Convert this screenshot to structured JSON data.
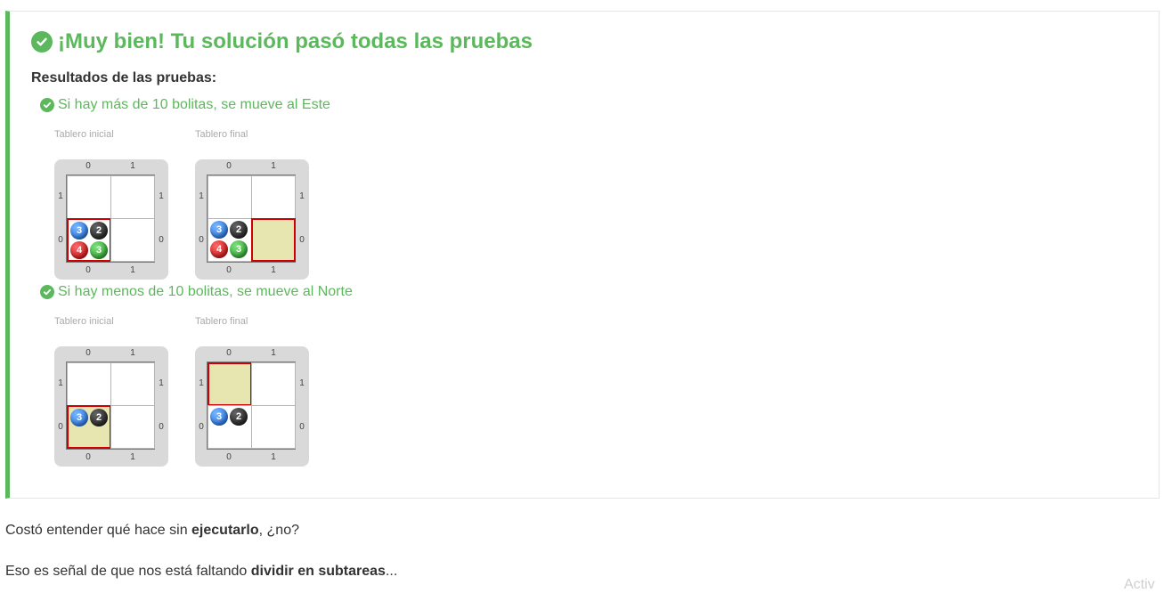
{
  "result": {
    "title": "¡Muy bien! Tu solución pasó todas las pruebas",
    "results_heading": "Resultados de las pruebas:",
    "accent_color": "#5cb85c",
    "icon": "check-circle-icon"
  },
  "tests": [
    {
      "title": "Si hay más de 10 bolitas, se mueve al Este",
      "initial_caption": "Tablero inicial",
      "final_caption": "Tablero final",
      "initial_board": {
        "col_labels": [
          "0",
          "1"
        ],
        "row_labels": [
          "1",
          "0"
        ],
        "header": "0,0",
        "balls": {
          "blue": "3",
          "black": "2",
          "red": "4",
          "green": "3"
        }
      },
      "final_board": {
        "col_labels": [
          "0",
          "1"
        ],
        "row_labels": [
          "1",
          "0"
        ],
        "header": "1,0",
        "balls": {
          "blue": "3",
          "black": "2",
          "red": "4",
          "green": "3"
        }
      }
    },
    {
      "title": "Si hay menos de 10 bolitas, se mueve al Norte",
      "initial_caption": "Tablero inicial",
      "final_caption": "Tablero final",
      "initial_board": {
        "col_labels": [
          "0",
          "1"
        ],
        "row_labels": [
          "1",
          "0"
        ],
        "header": "0,0",
        "balls": {
          "blue": "3",
          "black": "2"
        }
      },
      "final_board": {
        "col_labels": [
          "0",
          "1"
        ],
        "row_labels": [
          "1",
          "0"
        ],
        "header": "0,1",
        "balls": {
          "blue": "3",
          "black": "2"
        }
      }
    }
  ],
  "paragraphs": [
    {
      "before": "Costó entender qué hace sin ",
      "bold": "ejecutarlo",
      "after": ", ¿no?"
    },
    {
      "before": "Eso es señal de que nos está faltando ",
      "bold": "dividir en subtareas",
      "after": "..."
    }
  ],
  "watermark": "Activ"
}
